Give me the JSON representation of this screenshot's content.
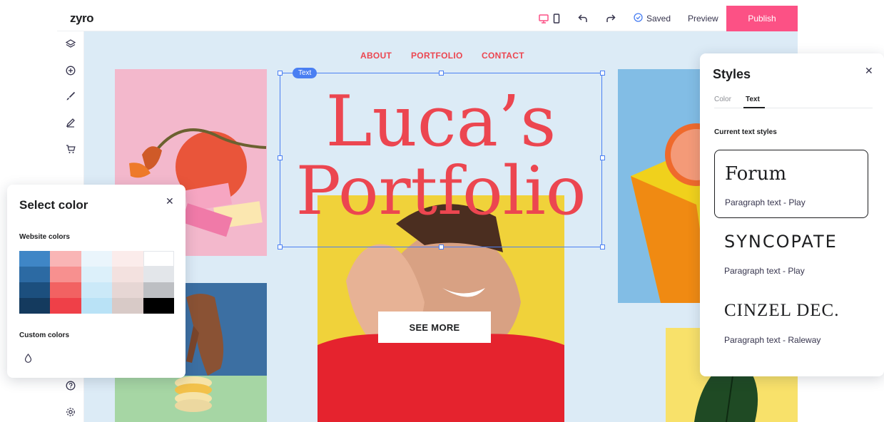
{
  "app": {
    "logo": "zyro",
    "saved_label": "Saved",
    "preview_label": "Preview",
    "publish_label": "Publish"
  },
  "site": {
    "nav": [
      "ABOUT",
      "PORTFOLIO",
      "CONTACT"
    ],
    "title_line1": "Luca’s",
    "title_line2": "Portfolio",
    "cta_label": "SEE MORE",
    "selection_tag": "Text"
  },
  "select_color": {
    "title": "Select color",
    "website_colors_label": "Website colors",
    "custom_colors_label": "Custom colors",
    "swatches": [
      "#3f86c6",
      "#f9b5b5",
      "#eaf5fc",
      "#fbeceb",
      "#ffffff",
      "#2c6aa3",
      "#f7908f",
      "#dcf0fa",
      "#f3e1df",
      "#e3e6ea",
      "#1c4f7e",
      "#f26262",
      "#cbe9f8",
      "#e6d6d4",
      "#bdbfc3",
      "#143a5e",
      "#ef4048",
      "#b9e2f6",
      "#d8cac7",
      "#000000"
    ]
  },
  "styles": {
    "title": "Styles",
    "tabs": [
      "Color",
      "Text"
    ],
    "active_tab": "Text",
    "current_label": "Current text styles",
    "fonts": [
      {
        "name": "Forum",
        "paragraph": "Paragraph text - Play"
      },
      {
        "name": "syncopate",
        "paragraph": "Paragraph text - Play"
      },
      {
        "name": "CINZEL DEC.",
        "paragraph": "Paragraph text - Raleway"
      }
    ]
  },
  "colors": {
    "accent": "#fc5185",
    "brand_red": "#ec4650",
    "selection_blue": "#4a7ff2"
  }
}
